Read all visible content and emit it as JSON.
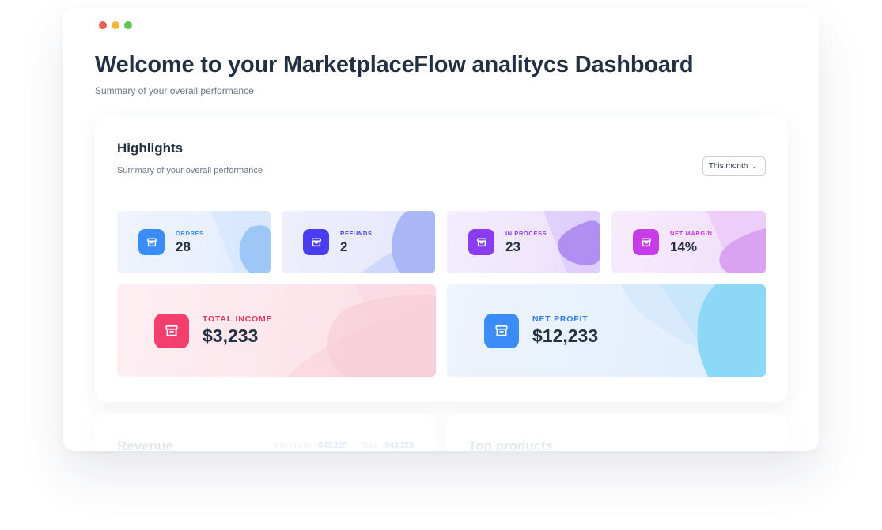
{
  "window": {
    "dots": [
      {
        "name": "close",
        "color": "#ee5e5a"
      },
      {
        "name": "minimize",
        "color": "#f5b63d"
      },
      {
        "name": "maximize",
        "color": "#5cc453"
      }
    ]
  },
  "page": {
    "title": "Welcome to your MarketplaceFlow analitycs Dashboard",
    "subtitle": "Summary of your overall performance"
  },
  "highlights": {
    "title": "Highlights",
    "subtitle": "Summary of your overall performance",
    "period": {
      "label": "This month",
      "icon": "chevron-down-icon"
    },
    "stats": [
      {
        "id": "orders",
        "label": "ORDRES",
        "value": "28",
        "icon": "archive-box-icon",
        "accent": "#3b8cf6",
        "label_color": "#3b8cf6"
      },
      {
        "id": "refunds",
        "label": "REFUNDS",
        "value": "2",
        "icon": "archive-box-icon",
        "accent": "#4a3cf0",
        "label_color": "#4a3cf0"
      },
      {
        "id": "in-process",
        "label": "IN PROCESS",
        "value": "23",
        "icon": "archive-box-icon",
        "accent": "#8a3cf0",
        "label_color": "#8a3cf0"
      },
      {
        "id": "net-margin",
        "label": "NET MARGIN",
        "value": "14%",
        "icon": "archive-box-icon",
        "accent": "#c63ce6",
        "label_color": "#c63ce6"
      },
      {
        "id": "total-income",
        "label": "TOTAL INCOME",
        "value": "$3,233",
        "icon": "archive-box-icon",
        "accent": "#f23f6e",
        "label_color": "#e3335f"
      },
      {
        "id": "net-profit",
        "label": "NET PROFIT",
        "value": "$12,233",
        "icon": "archive-box-icon",
        "accent": "#3b8cf6",
        "label_color": "#2f7ce6"
      }
    ]
  },
  "revenue": {
    "title": "Revenue",
    "this_month_label": "this month -",
    "this_month_value": "843,220",
    "total_label": "Total -",
    "total_value": "843,220"
  },
  "top_products": {
    "title": "Top products"
  }
}
